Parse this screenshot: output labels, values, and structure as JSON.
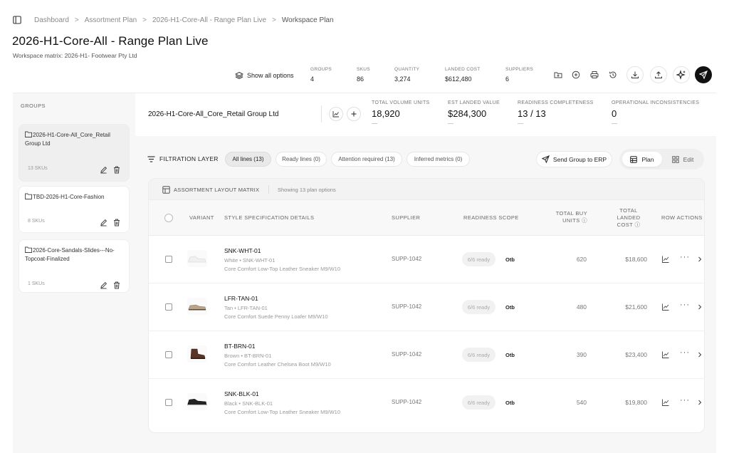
{
  "breadcrumb": [
    "Dashboard",
    "Assortment Plan",
    "2026-H1-Core-All - Range Plan Live",
    "Workspace Plan"
  ],
  "page": {
    "title": "2026-H1-Core-All - Range Plan Live",
    "subtitle": "Workspace matrix: 2026-H1- Footwear Pty Ltd"
  },
  "top": {
    "show_all": "Show all options",
    "stats": [
      {
        "label": "GROUPS",
        "value": "4"
      },
      {
        "label": "SKUS",
        "value": "86"
      },
      {
        "label": "QUANTITY",
        "value": "3,274"
      },
      {
        "label": "LANDED COST",
        "value": "$612,480"
      },
      {
        "label": "SUPPLIERS",
        "value": "6"
      }
    ],
    "toolbar_icons": [
      "folder-icon",
      "plus-circle-icon",
      "print-icon",
      "history-icon",
      "download-icon",
      "upload-icon",
      "sparkle-icon",
      "send-icon"
    ]
  },
  "sidebar": {
    "title": "GROUPS",
    "groups": [
      {
        "name": "2026-H1-Core-All_Core_Retail Group Ltd",
        "count": "13 SKUs",
        "active": true
      },
      {
        "name": "TBD-2026-H1-Core-Fashion",
        "count": "8 SKUs",
        "active": false
      },
      {
        "name": "2026-Core-Sandals-Slides---No-Topcoat-Finalized",
        "count": "1 SKUs",
        "active": false
      }
    ]
  },
  "group_header": {
    "name": "2026-H1-Core-All_Core_Retail Group Ltd",
    "kpis": [
      {
        "label": "TOTAL VOLUME UNITS",
        "value": "18,920"
      },
      {
        "label": "EST LANDED VALUE",
        "value": "$284,300"
      },
      {
        "label": "READINESS COMPLETENESS",
        "value": "13 / 13"
      },
      {
        "label": "OPERATIONAL INCONSISTENCIES",
        "value": "0"
      }
    ]
  },
  "filter": {
    "label": "FILTRATION LAYER",
    "pills": [
      {
        "label": "All lines (13)",
        "active": true
      },
      {
        "label": "Ready lines (0)",
        "active": false
      },
      {
        "label": "Attention required (13)",
        "active": false
      },
      {
        "label": "Inferred metrics (0)",
        "active": false
      }
    ],
    "send_erp": "Send Group to ERP",
    "view_plan": "Plan",
    "view_edit": "Edit"
  },
  "matrix": {
    "title": "ASSORTMENT LAYOUT MATRIX",
    "subtitle": "Showing 13 plan options",
    "columns": {
      "variant": "VARIANT",
      "style": "STYLE SPECIFICATION DETAILS",
      "supplier": "SUPPLIER",
      "readiness": "READINESS SCOPE",
      "units": "TOTAL BUY UNITS",
      "cost": "TOTAL LANDED COST",
      "actions": "ROW ACTIONS"
    },
    "rows": [
      {
        "sku": "SNK-WHT-01",
        "meta": "White • SNK-WHT-01",
        "desc": "Core Comfort Low-Top Leather Sneaker M9/W10",
        "supplier": "SUPP-1042",
        "readiness": "6/6 ready",
        "otb": "Otb",
        "units": "620",
        "cost": "$18,600",
        "shoe": "white-sneaker"
      },
      {
        "sku": "LFR-TAN-01",
        "meta": "Tan • LFR-TAN-01",
        "desc": "Core Comfort Suede Penny Loafer M9/W10",
        "supplier": "SUPP-1042",
        "readiness": "6/6 ready",
        "otb": "Otb",
        "units": "480",
        "cost": "$21,600",
        "shoe": "tan-loafer"
      },
      {
        "sku": "BT-BRN-01",
        "meta": "Brown • BT-BRN-01",
        "desc": "Core Comfort Leather Chelsea Boot M9/W10",
        "supplier": "SUPP-1042",
        "readiness": "6/6 ready",
        "otb": "Otb",
        "units": "390",
        "cost": "$23,400",
        "shoe": "brown-boot"
      },
      {
        "sku": "SNK-BLK-01",
        "meta": "Black • SNK-BLK-01",
        "desc": "Core Comfort Low-Top Leather Sneaker M9/W10",
        "supplier": "SUPP-1042",
        "readiness": "6/6 ready",
        "otb": "Otb",
        "units": "540",
        "cost": "$19,800",
        "shoe": "black-sneaker"
      }
    ]
  }
}
